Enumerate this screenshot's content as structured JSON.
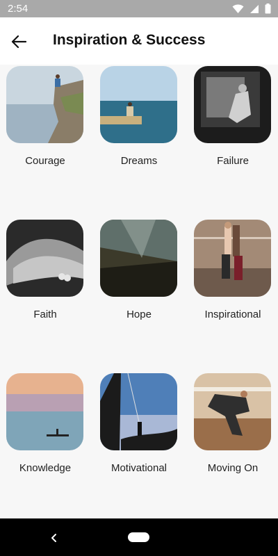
{
  "status_bar": {
    "time": "2:54",
    "icons": [
      "wifi-icon",
      "signal-icon",
      "battery-icon"
    ]
  },
  "app_bar": {
    "title": "Inspiration & Success",
    "back_icon": "arrow-left-icon"
  },
  "categories": [
    {
      "label": "Courage"
    },
    {
      "label": "Dreams"
    },
    {
      "label": "Failure"
    },
    {
      "label": "Faith"
    },
    {
      "label": "Hope"
    },
    {
      "label": "Inspirational"
    },
    {
      "label": "Knowledge"
    },
    {
      "label": "Motivational"
    },
    {
      "label": "Moving On"
    }
  ],
  "nav_bar": {
    "back_icon": "chevron-left-icon",
    "home_icon": "home-pill-icon"
  }
}
